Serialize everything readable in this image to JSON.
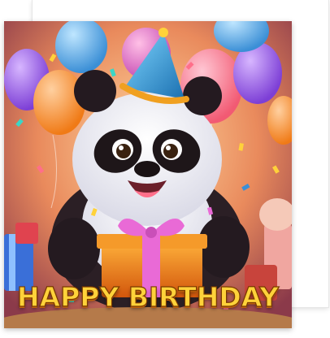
{
  "card": {
    "greeting": "HAPPY BIRTHDAY",
    "subject": "panda-with-party-hat",
    "colors": {
      "text_fill": "#ffd23a",
      "text_outline": "#7a3a00",
      "party_hat": "#2fa8e0",
      "gift_box": "#f08a1c",
      "gift_ribbon": "#e96ad6"
    }
  }
}
